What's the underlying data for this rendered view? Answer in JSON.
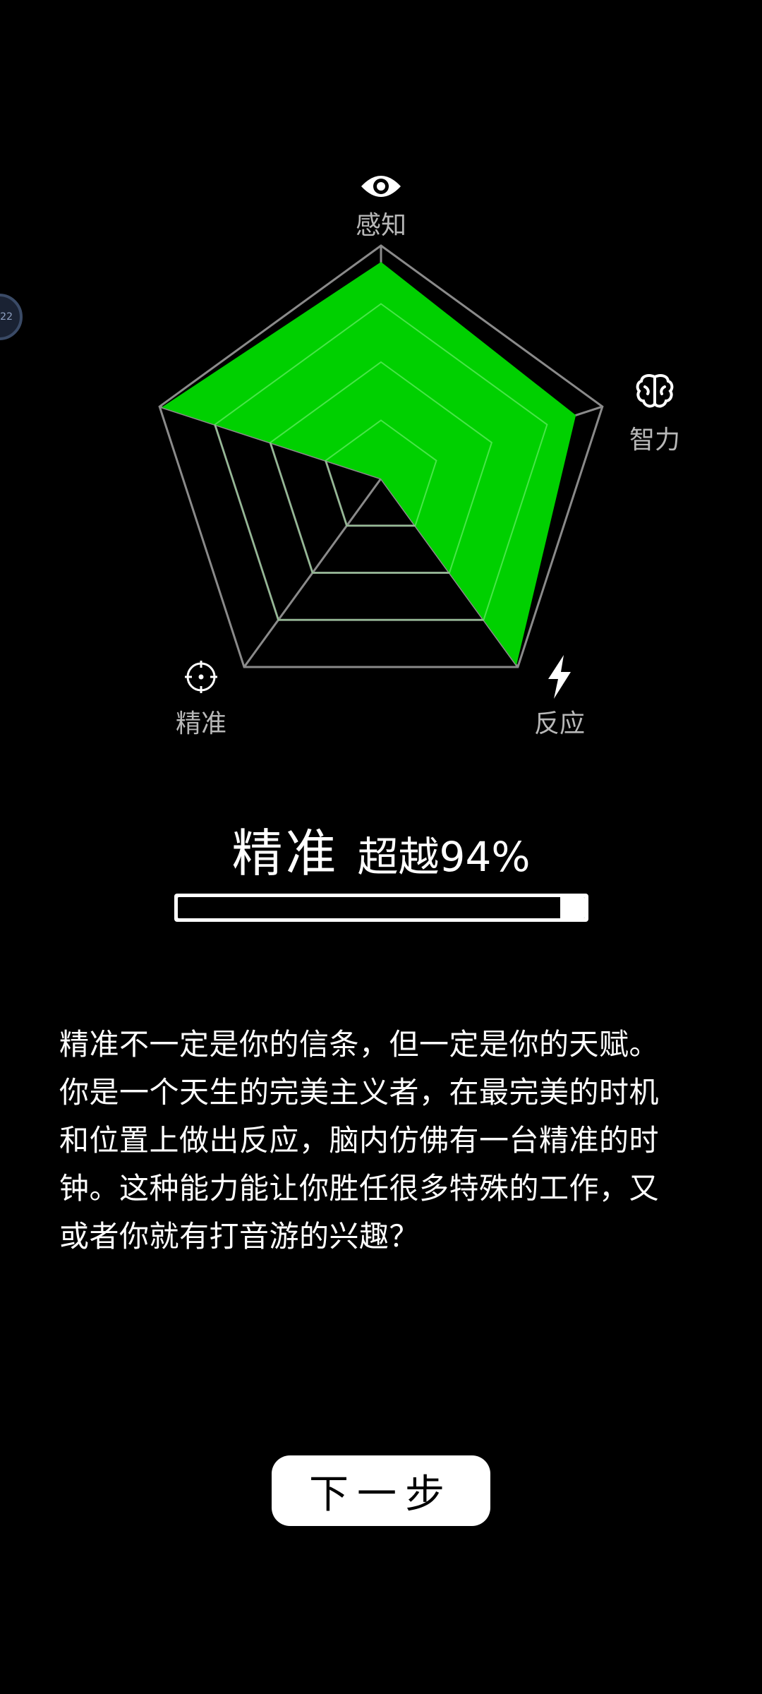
{
  "floating_widget": {
    "text": "22"
  },
  "radar": {
    "axes": [
      {
        "label": "感知",
        "icon": "eye-icon"
      },
      {
        "label": "智力",
        "icon": "brain-icon"
      },
      {
        "label": "反应",
        "icon": "lightning-icon"
      },
      {
        "label": "精准",
        "icon": "crosshair-icon"
      }
    ],
    "colors": {
      "fill": "#00d000",
      "grid": "#8a8a8a"
    }
  },
  "chart_data": {
    "type": "radar",
    "axes": [
      "感知",
      "智力",
      "反应",
      "",
      "精准"
    ],
    "values": [
      0.93,
      0.88,
      0.99,
      0.0,
      0.99
    ],
    "range": [
      0,
      1
    ],
    "grid_levels": 4
  },
  "result": {
    "dimension": "精准",
    "surpass_text": "超越94%",
    "percent": 94
  },
  "description": {
    "text": "精准不一定是你的信条，但一定是你的天赋。你是一个天生的完美主义者，在最完美的时机和位置上做出反应，脑内仿佛有一台精准的时钟。这种能力能让你胜任很多特殊的工作，又或者你就有打音游的兴趣？"
  },
  "next_button": {
    "label": "下一步"
  }
}
